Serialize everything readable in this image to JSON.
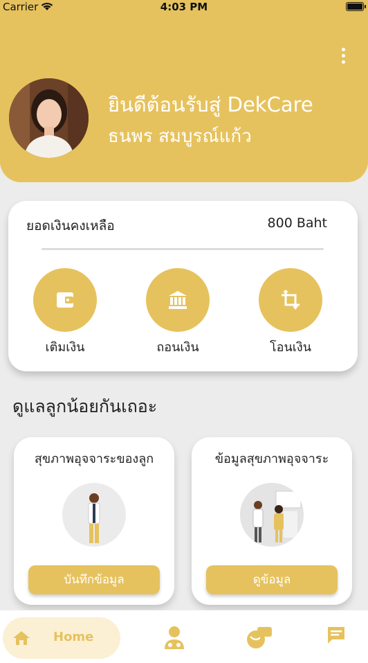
{
  "status_bar": {
    "carrier": "Carrier",
    "time": "4:03 PM"
  },
  "header": {
    "welcome": "ยินดีต้อนรับสู่ DekCare",
    "username": "ธนพร สมบูรณ์แก้ว",
    "menu_icon": "more-vertical-icon"
  },
  "balance": {
    "label": "ยอดเงินคงเหลือ",
    "value": "800 Baht",
    "actions": [
      {
        "label": "เติมเงิน",
        "icon": "wallet-icon"
      },
      {
        "label": "ถอนเงิน",
        "icon": "bank-icon"
      },
      {
        "label": "โอนเงิน",
        "icon": "transfer-icon"
      }
    ]
  },
  "section_title": "ดูแลลูกน้อยกันเถอะ",
  "services": [
    {
      "title": "สุขภาพอุจจาระของลูก",
      "button": "บันทึกข้อมูล"
    },
    {
      "title": "ข้อมูลสุขภาพอุจจาระ",
      "button": "ดูข้อมูล"
    }
  ],
  "tabbar": {
    "home": "Home",
    "icons": [
      "home-icon",
      "doctor-icon",
      "health-chat-icon",
      "message-icon"
    ]
  },
  "colors": {
    "accent": "#e6c25e",
    "background": "#ececec"
  }
}
